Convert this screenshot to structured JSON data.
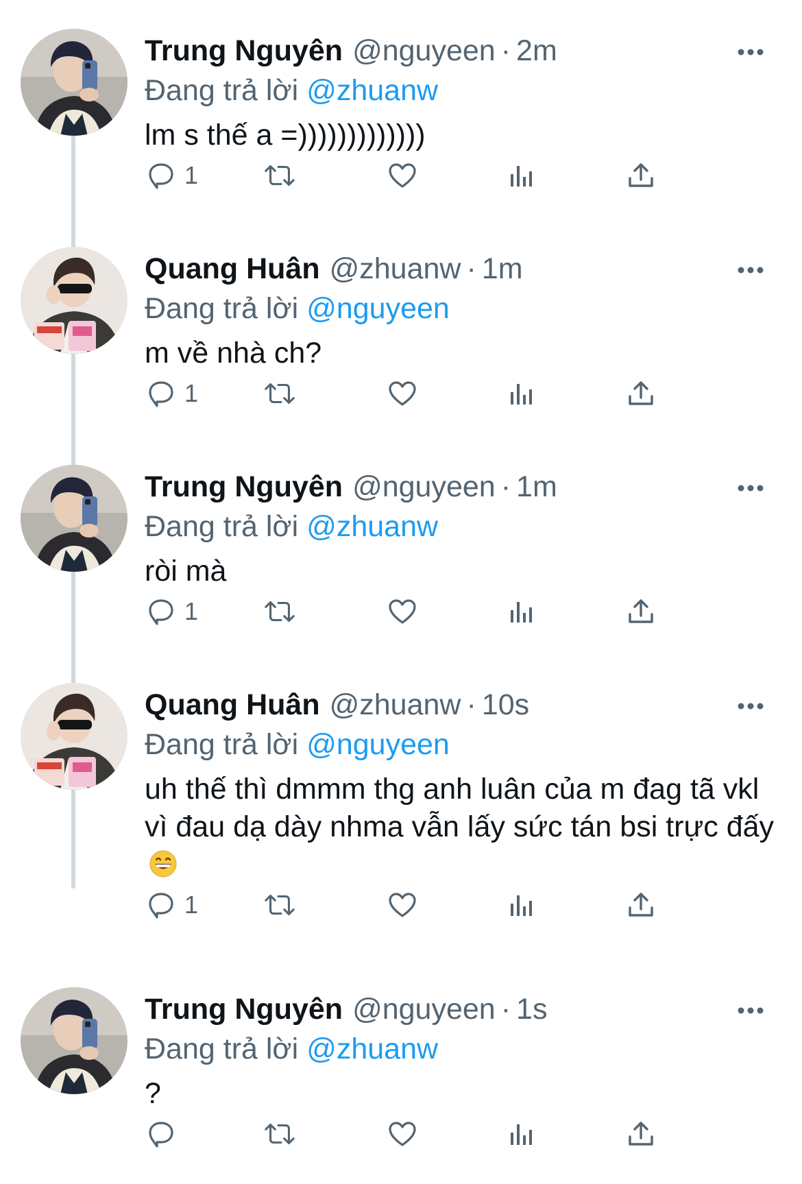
{
  "thread": {
    "tweets": [
      {
        "name": "Trung Nguyên",
        "handle": "@nguyeen",
        "separator": "·",
        "time": "2m",
        "replying_prefix": "Đang trả lời",
        "replying_to": "@zhuanw",
        "text": "lm s thế a =)))))))))))))",
        "emoji": "",
        "reply_count": "1",
        "avatar": "trung-avatar"
      },
      {
        "name": "Quang Huân",
        "handle": "@zhuanw",
        "separator": "·",
        "time": "1m",
        "replying_prefix": "Đang trả lời",
        "replying_to": "@nguyeen",
        "text": "m về nhà ch?",
        "emoji": "",
        "reply_count": "1",
        "avatar": "quang-avatar"
      },
      {
        "name": "Trung Nguyên",
        "handle": "@nguyeen",
        "separator": "·",
        "time": "1m",
        "replying_prefix": "Đang trả lời",
        "replying_to": "@zhuanw",
        "text": "ròi mà",
        "emoji": "",
        "reply_count": "1",
        "avatar": "trung-avatar"
      },
      {
        "name": "Quang Huân",
        "handle": "@zhuanw",
        "separator": "·",
        "time": "10s",
        "replying_prefix": "Đang trả lời",
        "replying_to": "@nguyeen",
        "text": "uh thế thì dmmm thg anh luân của m đag tã vkl vì đau dạ dày nhma vẫn lấy sức tán bsi trực đấy",
        "emoji": "grinning-face-emoji",
        "reply_count": "1",
        "avatar": "quang-avatar"
      },
      {
        "name": "Trung Nguyên",
        "handle": "@nguyeen",
        "separator": "·",
        "time": "1s",
        "replying_prefix": "Đang trả lời",
        "replying_to": "@zhuanw",
        "text": "?",
        "emoji": "",
        "reply_count": "",
        "avatar": "trung-avatar"
      }
    ]
  },
  "colors": {
    "primary_text": "#0f1419",
    "secondary_text": "#536471",
    "link": "#1d9bf0",
    "thread_line": "#cfd9de"
  },
  "icons": {
    "reply": "speech-bubble-icon",
    "retweet": "retweet-arrows-icon",
    "like": "heart-icon",
    "views": "bar-chart-icon",
    "share": "upload-arrow-icon",
    "more": "three-dots-icon"
  }
}
